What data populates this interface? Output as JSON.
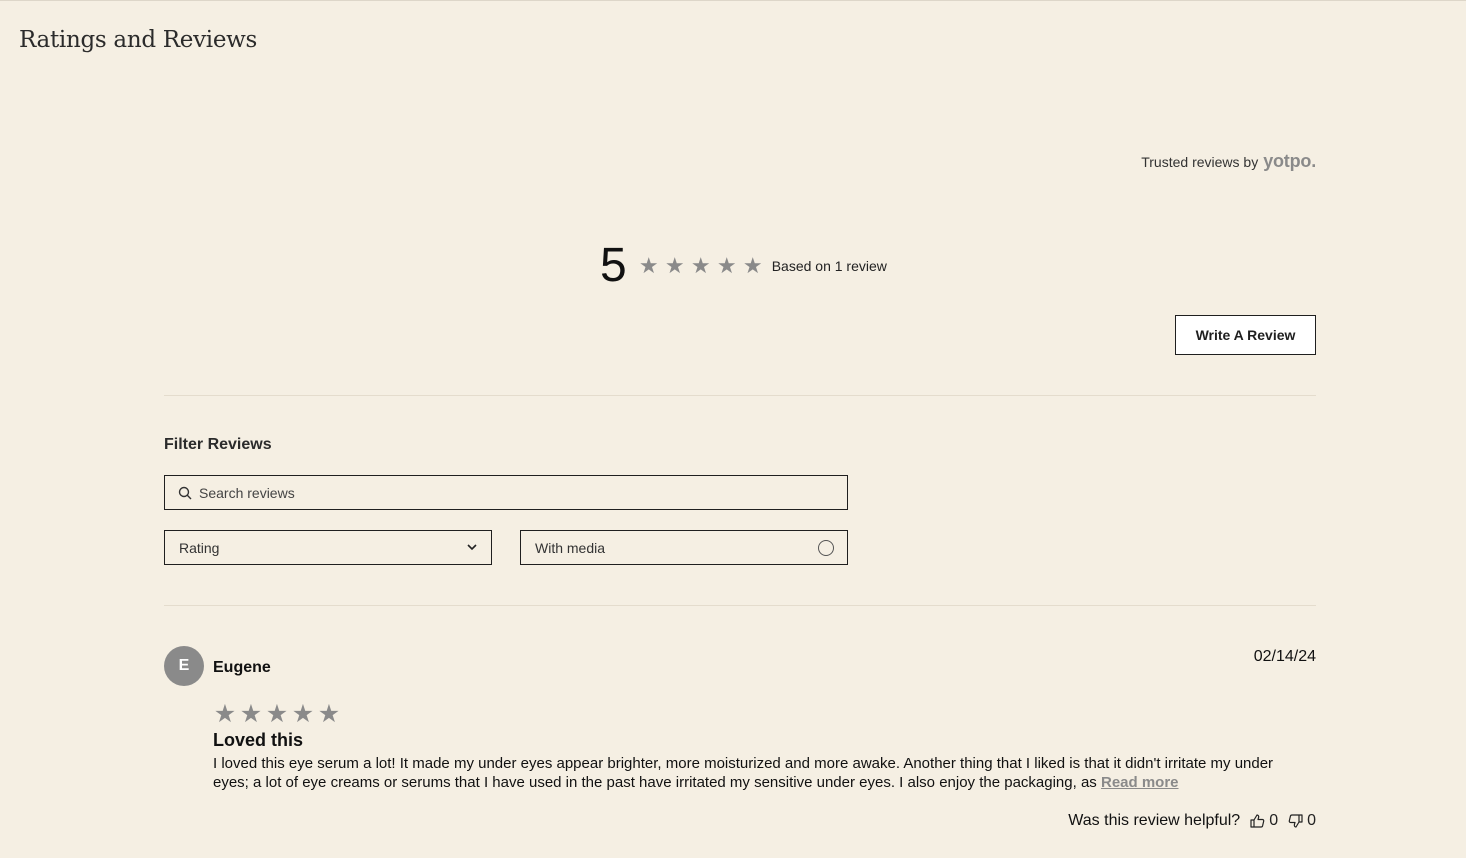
{
  "header": {
    "title": "Ratings and Reviews"
  },
  "provider": {
    "prefix": "Trusted reviews by",
    "brand": "yotpo."
  },
  "summary": {
    "average": "5",
    "star_count": 5,
    "based_on": "Based on 1 review"
  },
  "actions": {
    "write_review": "Write A Review"
  },
  "filters": {
    "title": "Filter Reviews",
    "search_placeholder": "Search reviews",
    "rating_label": "Rating",
    "media_label": "With media"
  },
  "reviews": [
    {
      "avatar_initial": "E",
      "author": "Eugene",
      "date": "02/14/24",
      "rating": 5,
      "title": "Loved this",
      "body": "I loved this eye serum a lot! It made my under eyes appear brighter, more moisturized and more awake. Another thing that I liked is that it didn't irritate my under eyes; a lot of eye creams or serums that I have used in the past have irritated my sensitive under eyes. I also enjoy the packaging, as",
      "read_more": "Read more",
      "helpful_prompt": "Was this review helpful?",
      "upvotes": "0",
      "downvotes": "0"
    }
  ],
  "colors": {
    "background": "#f5efe3",
    "star": "#8a8a8a",
    "border": "#1f1f1f"
  },
  "icons": {
    "star": "star-icon",
    "search": "search-icon",
    "dropdown": "chevron-down-icon",
    "media": "radio-circle-icon",
    "upvote": "thumbs-up-icon",
    "downvote": "thumbs-down-icon"
  }
}
